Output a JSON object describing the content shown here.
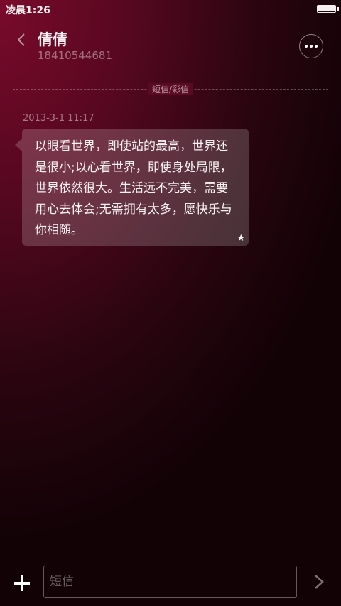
{
  "status_bar": {
    "time": "凌晨1:26",
    "battery_level": 1.0
  },
  "header": {
    "contact_name": "倩倩",
    "phone_number": "18410544681",
    "back_icon": "chevron-left-icon",
    "more_icon": "more-horizontal-icon"
  },
  "conversation": {
    "divider_label": "短信/彩信",
    "messages": [
      {
        "timestamp": "2013-3-1 11:17",
        "text": "以眼看世界，即使站的最高，世界还是很小;以心看世界，即使身处局限，世界依然很大。生活远不完美，需要用心去体会;无需拥有太多，愿快乐与你相随。",
        "starred": true,
        "star_icon": "star-icon"
      }
    ]
  },
  "compose": {
    "placeholder": "短信",
    "value": "",
    "add_icon": "plus-icon",
    "send_icon": "chevron-right-icon"
  },
  "colors": {
    "background_top": "#7a0a2c",
    "background_bottom": "#120206",
    "text_primary": "#f4eef0"
  }
}
